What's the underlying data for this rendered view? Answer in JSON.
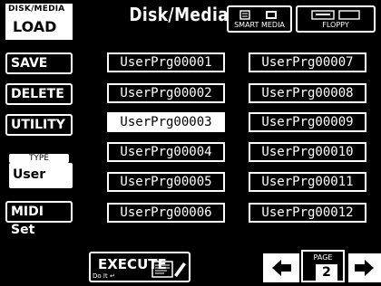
{
  "header": {
    "tab_label": "DISK/MEDIA",
    "load_label": "LOAD",
    "title": "Disk/Media",
    "smart_media_label": "SMART MEDIA",
    "floppy_label": "FLOPPY"
  },
  "left_menu": {
    "save_label": "SAVE",
    "delete_label": "DELETE",
    "utility_label": "UTILITY",
    "type_label": "TYPE",
    "type_value": "User Prg",
    "midi_set_label": "MIDI Set"
  },
  "files": {
    "col1": [
      "UserPrg00001",
      "UserPrg00002",
      "UserPrg00003",
      "UserPrg00004",
      "UserPrg00005",
      "UserPrg00006"
    ],
    "col2": [
      "UserPrg00007",
      "UserPrg00008",
      "UserPrg00009",
      "UserPrg00010",
      "UserPrg00011",
      "UserPrg00012"
    ],
    "selected": "UserPrg00003"
  },
  "footer": {
    "execute_label": "EXECUTE",
    "do_it_label": "Do It",
    "page_label": "PAGE",
    "page_number": "2"
  },
  "icons": [
    "smart-media-icon",
    "floppy-icon",
    "execute-icon",
    "arrow-left-icon",
    "arrow-right-icon"
  ],
  "colors": {
    "background": "#000000",
    "foreground": "#ffffff"
  }
}
